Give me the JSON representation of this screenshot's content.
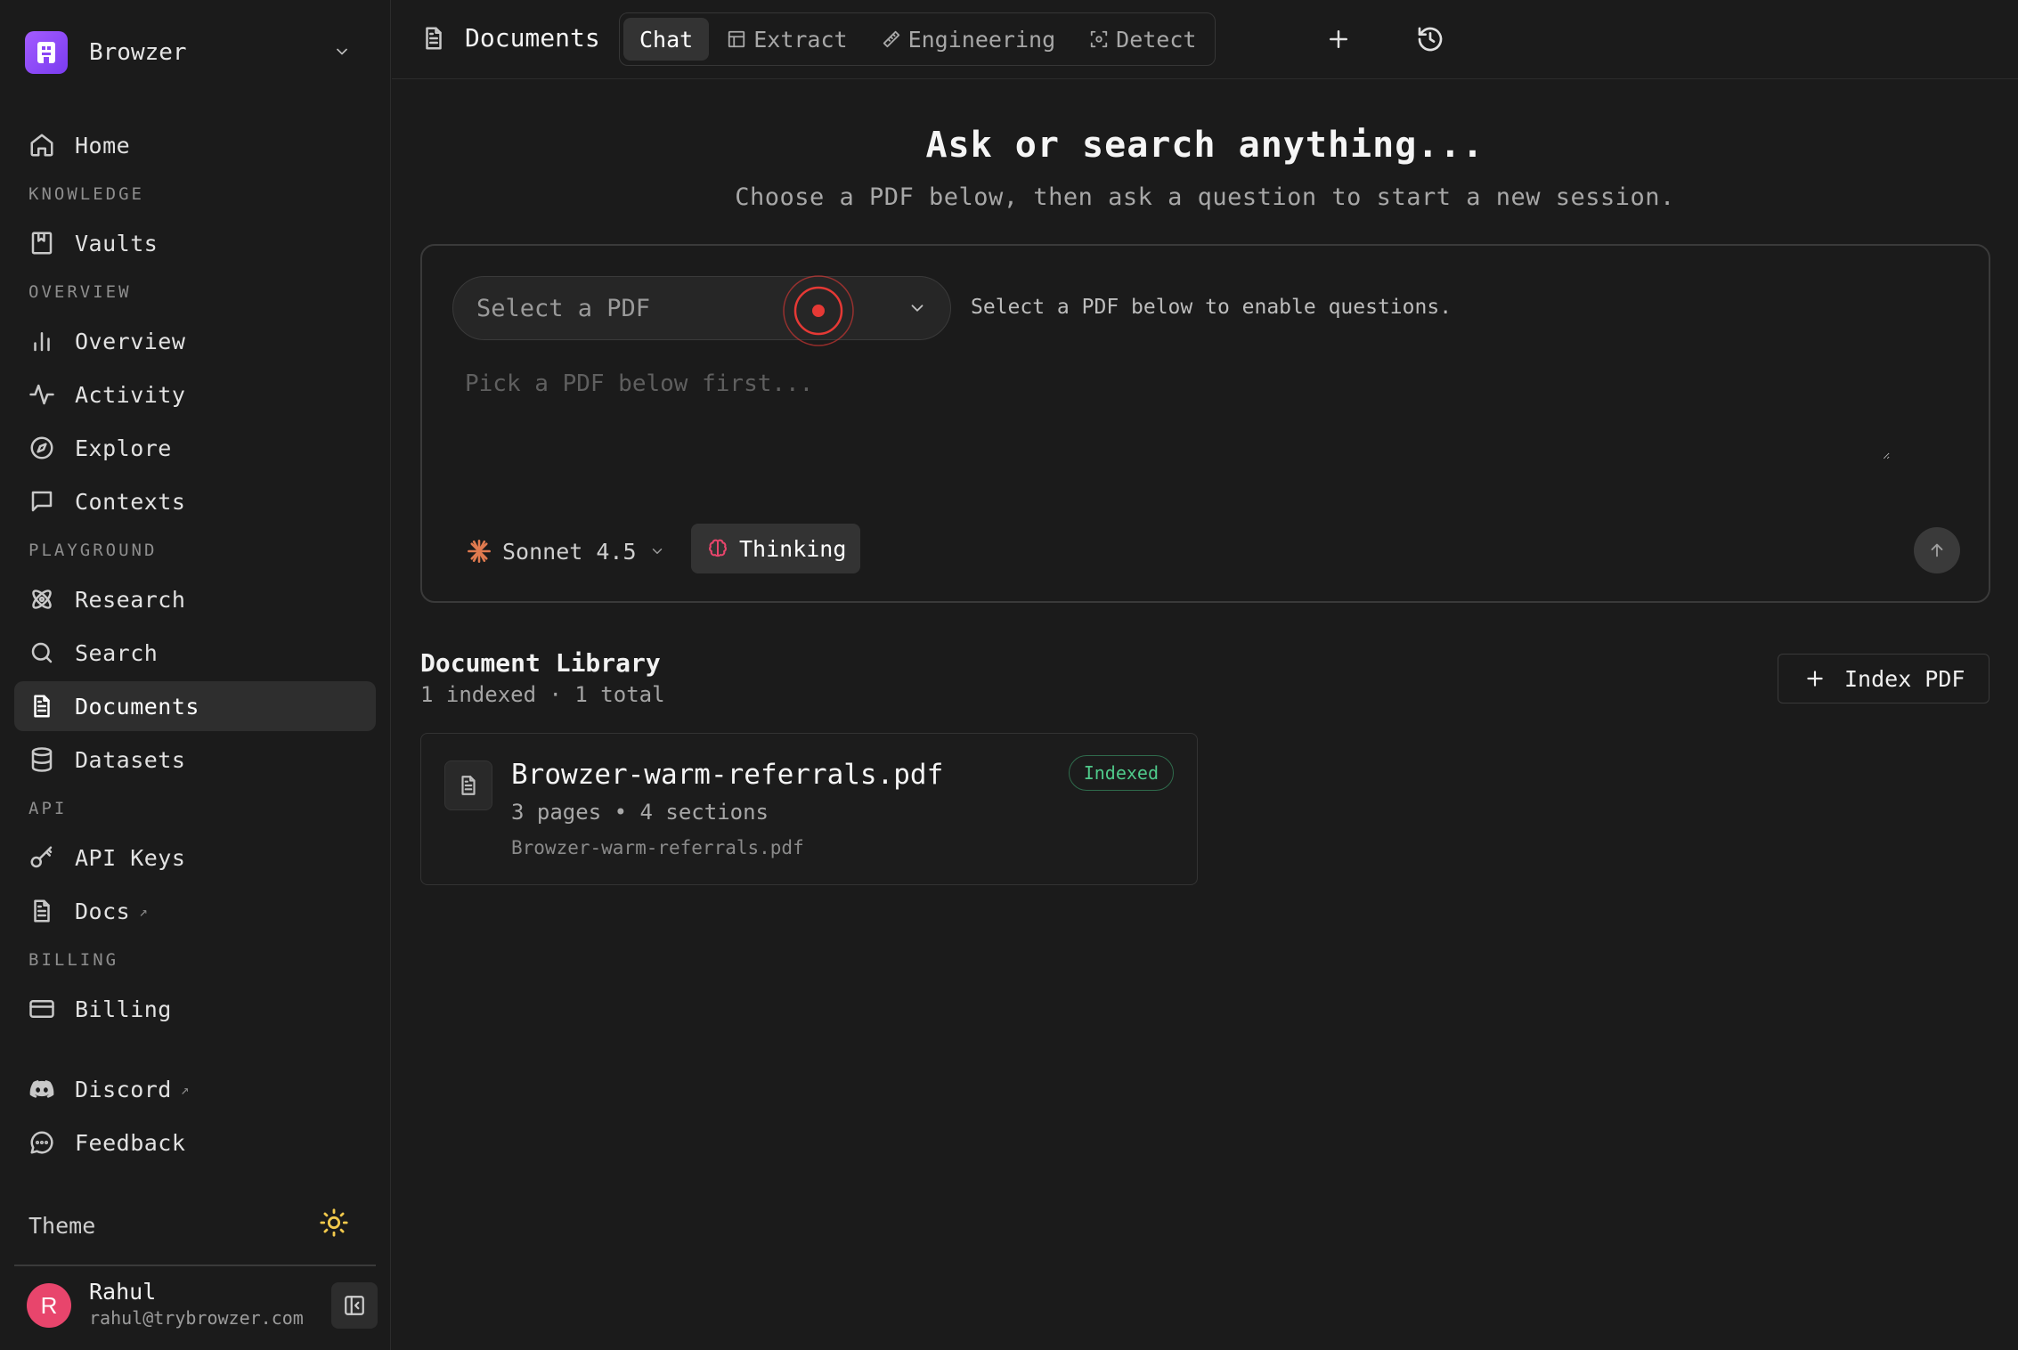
{
  "brand": {
    "name": "Browzer"
  },
  "sidebar": {
    "home": "Home",
    "sections": {
      "knowledge": "KNOWLEDGE",
      "overview": "OVERVIEW",
      "playground": "PLAYGROUND",
      "api": "API",
      "billing": "BILLING"
    },
    "items": {
      "vaults": "Vaults",
      "overview": "Overview",
      "activity": "Activity",
      "explore": "Explore",
      "contexts": "Contexts",
      "research": "Research",
      "search": "Search",
      "documents": "Documents",
      "datasets": "Datasets",
      "api_keys": "API Keys",
      "docs": "Docs",
      "billing": "Billing",
      "discord": "Discord",
      "feedback": "Feedback"
    },
    "external_marker": "↗",
    "theme_label": "Theme",
    "user": {
      "initial": "R",
      "name": "Rahul",
      "email": "rahul@trybrowzer.com"
    }
  },
  "header": {
    "title": "Documents",
    "tabs": [
      "Chat",
      "Extract",
      "Engineering",
      "Detect"
    ],
    "active_tab": "Chat"
  },
  "hero": {
    "title": "Ask or search anything...",
    "subtitle": "Choose a PDF below, then ask a question to start a new session."
  },
  "composer": {
    "pdf_select_placeholder": "Select a PDF",
    "select_hint": "Select a PDF below to enable questions.",
    "question_placeholder": "Pick a PDF below first...",
    "model": "Sonnet 4.5",
    "thinking_label": "Thinking"
  },
  "library": {
    "title": "Document Library",
    "summary": "1 indexed · 1 total",
    "index_button": "Index PDF",
    "documents": [
      {
        "name": "Browzer-warm-referrals.pdf",
        "meta": "3 pages • 4 sections",
        "file": "Browzer-warm-referrals.pdf",
        "status": "Indexed"
      }
    ]
  },
  "colors": {
    "background": "#1b1b1b",
    "brand": "#9b51ff",
    "status_indexed": "#4fc98a",
    "avatar": "#e8456c",
    "theme_icon": "#f2c94c",
    "marker": "#e53935"
  }
}
